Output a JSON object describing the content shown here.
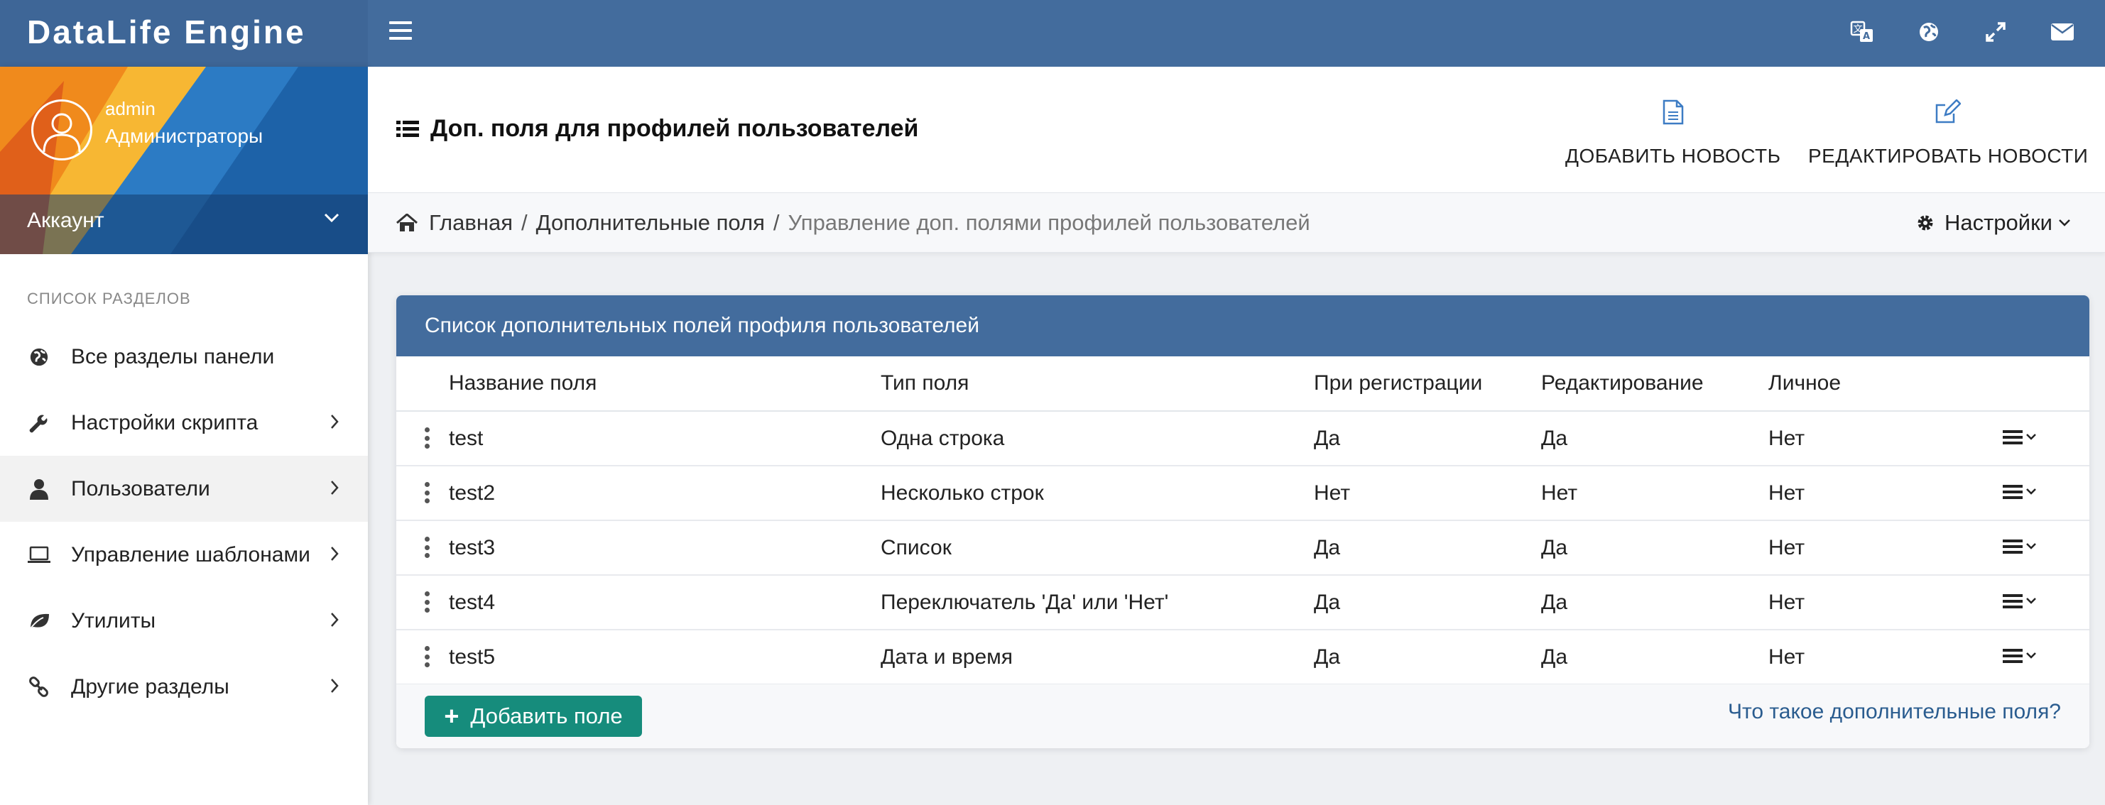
{
  "app": {
    "brand": "DataLife Engine"
  },
  "topbar": {
    "icons": [
      "translate-icon",
      "globe-icon",
      "expand-icon",
      "envelope-icon"
    ]
  },
  "sidebar": {
    "user": {
      "name": "admin",
      "group": "Администраторы"
    },
    "account_label": "Аккаунт",
    "section_title": "СПИСОК РАЗДЕЛОВ",
    "items": [
      {
        "label": "Все разделы панели",
        "icon": "globe-icon",
        "has_children": false
      },
      {
        "label": "Настройки скрипта",
        "icon": "wrench-icon",
        "has_children": true
      },
      {
        "label": "Пользователи",
        "icon": "user-icon",
        "has_children": true,
        "active": true
      },
      {
        "label": "Управление шаблонами",
        "icon": "laptop-icon",
        "has_children": true
      },
      {
        "label": "Утилиты",
        "icon": "leaf-icon",
        "has_children": true
      },
      {
        "label": "Другие разделы",
        "icon": "link-icon",
        "has_children": true
      }
    ]
  },
  "header": {
    "title": "Доп. поля для профилей пользователей",
    "add_news": "ДОБАВИТЬ НОВОСТЬ",
    "edit_news": "РЕДАКТИРОВАТЬ НОВОСТИ"
  },
  "breadcrumb": {
    "items": [
      "Главная",
      "Дополнительные поля"
    ],
    "current": "Управление доп. полями профилей пользователей",
    "separator": "/",
    "settings": "Настройки"
  },
  "panel": {
    "title": "Список дополнительных полей профиля пользователей",
    "columns": [
      "Название поля",
      "Тип поля",
      "При регистрации",
      "Редактирование",
      "Личное"
    ],
    "rows": [
      [
        "test",
        "Одна строка",
        "Да",
        "Да",
        "Нет"
      ],
      [
        "test2",
        "Несколько строк",
        "Нет",
        "Нет",
        "Нет"
      ],
      [
        "test3",
        "Список",
        "Да",
        "Да",
        "Нет"
      ],
      [
        "test4",
        "Переключатель 'Да' или 'Нет'",
        "Да",
        "Да",
        "Нет"
      ],
      [
        "test5",
        "Дата и время",
        "Да",
        "Да",
        "Нет"
      ]
    ],
    "add_button": "Добавить поле",
    "help_link": "Что такое дополнительные поля?"
  },
  "colors": {
    "primary": "#436c9d",
    "button": "#168c7c",
    "link": "#2a5c8f"
  }
}
